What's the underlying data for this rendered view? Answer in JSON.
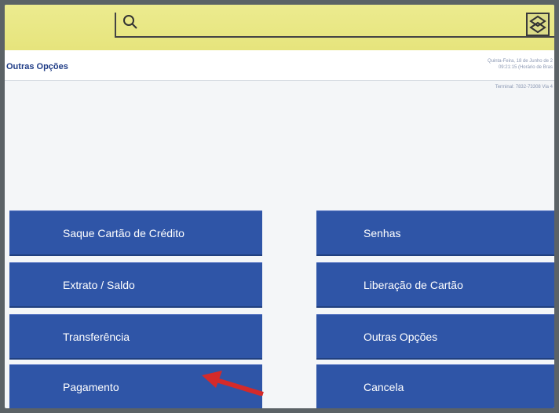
{
  "search": {
    "placeholder": ""
  },
  "header": {
    "section_title": "Outras Opções",
    "datetime_line1": "Quinta-Feira, 18 de Junho de 2",
    "datetime_line2": "09:21:15 (Horário de Bras",
    "terminal": "Terminal: 7832-73308 Via 4"
  },
  "menu": {
    "left": [
      {
        "label": "Saque Cartão de Crédito"
      },
      {
        "label": "Extrato / Saldo"
      },
      {
        "label": "Transferência"
      },
      {
        "label": "Pagamento"
      }
    ],
    "right": [
      {
        "label": "Senhas"
      },
      {
        "label": "Liberação de Cartão"
      },
      {
        "label": "Outras Opções"
      },
      {
        "label": "Cancela"
      }
    ]
  },
  "colors": {
    "topbar": "#e6e47c",
    "button": "#2f55a7",
    "arrow": "#d42a2a",
    "section_title": "#1f3c86"
  },
  "icons": {
    "search": "search-icon",
    "logo": "bank-logo-icon",
    "arrow": "red-arrow-icon"
  }
}
